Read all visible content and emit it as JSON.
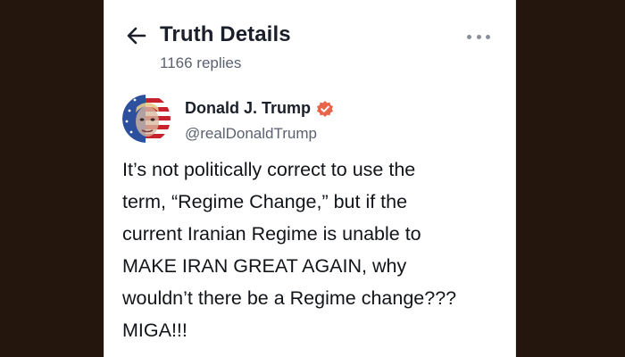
{
  "header": {
    "title": "Truth Details",
    "replies": "1166 replies",
    "icons": {
      "back": "back-arrow-icon",
      "more": "more-options-icon"
    }
  },
  "author": {
    "name": "Donald J. Trump",
    "handle": "@realDonaldTrump",
    "verified_icon": "verified-badge-icon",
    "verified_color": "#e8644a"
  },
  "post": {
    "lines": [
      "It’s not politically correct to use the",
      "term, “Regime Change,” but if the",
      "current Iranian Regime is unable to",
      "MAKE IRAN GREAT AGAIN, why",
      "wouldn’t there be a Regime change???",
      "MIGA!!!"
    ]
  },
  "colors": {
    "background": "#24160d",
    "card": "#ffffff",
    "text_primary": "#1b1f2a",
    "text_secondary": "#5b6170"
  }
}
